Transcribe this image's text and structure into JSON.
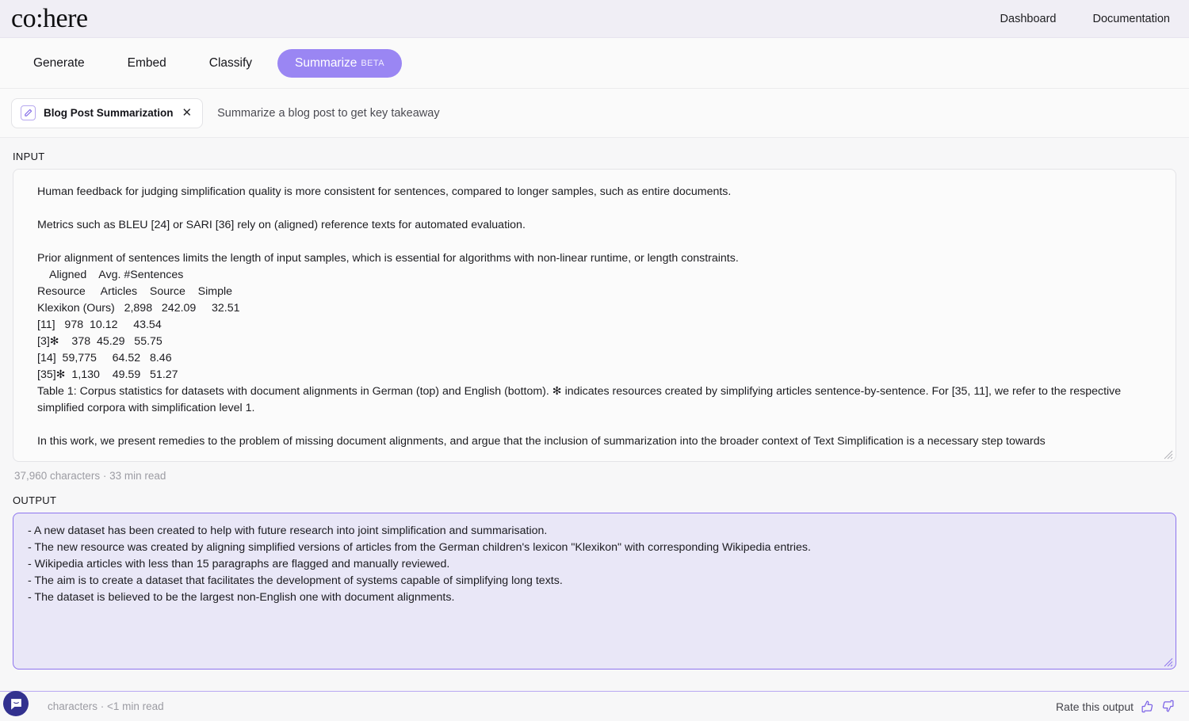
{
  "brand": {
    "logo_text": "co:here",
    "nav": [
      {
        "label": "Dashboard"
      },
      {
        "label": "Documentation"
      }
    ]
  },
  "product_tabs": [
    {
      "label": "Generate",
      "active": false,
      "badge": ""
    },
    {
      "label": "Embed",
      "active": false,
      "badge": ""
    },
    {
      "label": "Classify",
      "active": false,
      "badge": ""
    },
    {
      "label": "Summarize",
      "active": true,
      "badge": "BETA"
    }
  ],
  "preset": {
    "icon": "pencil-square-icon",
    "name": "Blog Post Summarization",
    "close_icon": "close-icon",
    "description": "Summarize a blog post to get key takeaway"
  },
  "input": {
    "label": "INPUT",
    "paragraphs": [
      "Human feedback for judging simplification quality is more consistent for sentences, compared to longer samples, such as entire documents.",
      "",
      "Metrics such as BLEU [24] or SARI [36] rely on (aligned) reference texts for automated evaluation.",
      "",
      "Prior alignment of sentences limits the length of input samples, which is essential for algorithms with non-linear runtime, or length constraints.",
      ""
    ],
    "table_lines": [
      "    Aligned    Avg. #Sentences",
      "Resource     Articles    Source    Simple",
      "Klexikon (Ours)   2,898   242.09     32.51",
      "[11]   978  10.12     43.54",
      "[3]✻    378  45.29   55.75",
      "[14]  59,775     64.52   8.46",
      "[35]✻  1,130    49.59   51.27"
    ],
    "caption": "Table 1: Corpus statistics for datasets with document alignments in German (top) and English (bottom). ✻ indicates resources created by simplifying articles sentence-by-sentence. For [35, 11], we refer to the respective simplified corpora with simplification level 1.",
    "trailing_paragraph": "In this work, we present remedies to the problem of missing document alignments, and argue that the inclusion of summarization into the broader context of Text Simplification is a necessary step towards",
    "meta": "37,960 characters · 33 min read",
    "resize_handle": "resize-grip-icon"
  },
  "output": {
    "label": "OUTPUT",
    "lines": [
      "- A new dataset has been created to help with future research into joint simplification and summarisation.",
      "- The new resource was created by aligning simplified versions of articles from the German children's lexicon \"Klexikon\" with corresponding Wikipedia entries.",
      "- Wikipedia articles with less than 15 paragraphs are flagged and manually reviewed.",
      "- The aim is to create a dataset that facilitates the development of systems capable of simplifying long texts.",
      "- The dataset is believed to be the largest non-English one with document alignments."
    ],
    "meta": "characters · <1 min read",
    "resize_handle": "resize-grip-icon"
  },
  "footer": {
    "rate_label": "Rate this output",
    "thumb_up": "thumbs-up-icon",
    "thumb_down": "thumbs-down-icon"
  },
  "chat_widget": {
    "icon": "intercom-chat-icon"
  },
  "colors": {
    "accent": "#9a86f3",
    "accent_border": "#8d74ee",
    "output_bg": "#e9e7f7",
    "brandbar_bg": "#f0eef5",
    "page_bg": "#f7f7f8",
    "intercom": "#32318f",
    "muted_text": "#9c9ca3"
  }
}
